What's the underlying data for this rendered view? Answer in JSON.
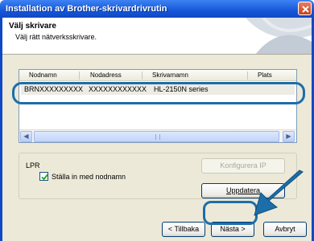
{
  "window": {
    "title": "Installation av Brother-skrivardrivrutin"
  },
  "header": {
    "title": "Välj skrivare",
    "subtitle": "Välj rätt nätverksskrivare."
  },
  "printer_list": {
    "columns": [
      "Nodnamn",
      "Nodadress",
      "Skrivarnamn",
      "Plats"
    ],
    "rows": [
      {
        "node_name": "BRNXXXXXXXXX",
        "node_address": "XXXXXXXXXXXX",
        "printer_name": "HL-2150N series"
      }
    ]
  },
  "lpr": {
    "group_label": "LPR",
    "checkbox_label": "Ställa in med nodnamn",
    "checkbox_checked": true
  },
  "buttons": {
    "configure_ip": "Konfigurera IP",
    "refresh": "Uppdatera",
    "back": "< Tillbaka",
    "next": "Nästa >",
    "cancel": "Avbryt"
  },
  "colors": {
    "title_bar": "#1657d8",
    "highlight_outline": "#1d6ea8",
    "dialog_background": "#ece9d8"
  }
}
